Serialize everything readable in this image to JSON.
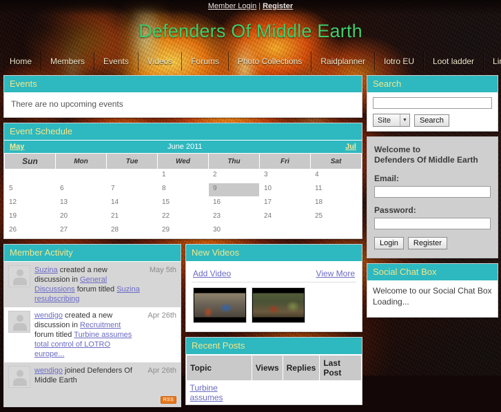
{
  "topbar": {
    "member_login": "Member Login",
    "separator": "|",
    "register": "Register"
  },
  "site": {
    "title": "Defenders Of Middle Earth"
  },
  "nav": {
    "items": [
      {
        "label": "Home"
      },
      {
        "label": "Members"
      },
      {
        "label": "Events"
      },
      {
        "label": "Videos"
      },
      {
        "label": "Forums"
      },
      {
        "label": "Photo Collections"
      },
      {
        "label": "Raidplanner"
      },
      {
        "label": "Iotro EU"
      },
      {
        "label": "Loot ladder"
      },
      {
        "label": "Links"
      }
    ]
  },
  "events": {
    "title": "Events",
    "empty_text": "There are no upcoming events"
  },
  "schedule": {
    "title": "Event Schedule",
    "prev_month": "May",
    "current_month": "June 2011",
    "next_month": "Jul",
    "weekdays": [
      "Sun",
      "Mon",
      "Tue",
      "Wed",
      "Thu",
      "Fri",
      "Sat"
    ],
    "weeks": [
      [
        "",
        "",
        "",
        "1",
        "2",
        "3",
        "4"
      ],
      [
        "5",
        "6",
        "7",
        "8",
        "9",
        "10",
        "11"
      ],
      [
        "12",
        "13",
        "14",
        "15",
        "16",
        "17",
        "18"
      ],
      [
        "19",
        "20",
        "21",
        "22",
        "23",
        "24",
        "25"
      ],
      [
        "26",
        "27",
        "28",
        "29",
        "30",
        "",
        ""
      ]
    ],
    "today": "9"
  },
  "member_activity": {
    "title": "Member Activity",
    "rss_label": "RSS",
    "items": [
      {
        "user": "Suzina",
        "text_1": " created a new discussion in ",
        "forum": "General Discussions",
        "text_2": " forum titled ",
        "topic": "Suzina resubscribing",
        "date": "May 5th"
      },
      {
        "user": "wendigo",
        "text_1": " created a new discussion in ",
        "forum": "Recruitment",
        "text_2": " forum titled ",
        "topic": "Turbine assumes total control of LOTRO europe...",
        "date": "Apr 26th"
      },
      {
        "user": "wendigo",
        "text_1": " joined Defenders Of Middle Earth",
        "forum": "",
        "text_2": "",
        "topic": "",
        "date": "Apr 26th"
      }
    ]
  },
  "new_videos": {
    "title": "New Videos",
    "add_label": "Add Video",
    "view_more_label": "View More",
    "thumbnails": [
      {
        "alt": "video-thumbnail-1"
      },
      {
        "alt": "video-thumbnail-2"
      }
    ]
  },
  "recent_posts": {
    "title": "Recent Posts",
    "columns": [
      "Topic",
      "Views",
      "Replies",
      "Last Post"
    ],
    "rows": [
      {
        "topic": "Turbine assumes",
        "views": "",
        "replies": "",
        "last_post": ""
      }
    ]
  },
  "search": {
    "title": "Search",
    "query": "",
    "scope_selected": "Site",
    "button_label": "Search"
  },
  "login": {
    "welcome_line_1": "Welcome to",
    "welcome_line_2": "Defenders Of Middle Earth",
    "email_label": "Email:",
    "email_value": "",
    "password_label": "Password:",
    "password_value": "",
    "login_button": "Login",
    "register_button": "Register"
  },
  "chat": {
    "title": "Social Chat Box",
    "line_1": "Welcome to our Social Chat Box",
    "line_2": "Loading..."
  },
  "colors": {
    "teal": "#2eb8bf",
    "title_green": "#3fcd6b",
    "panel_title": "#f2e68a",
    "link": "#6a6ac4"
  }
}
